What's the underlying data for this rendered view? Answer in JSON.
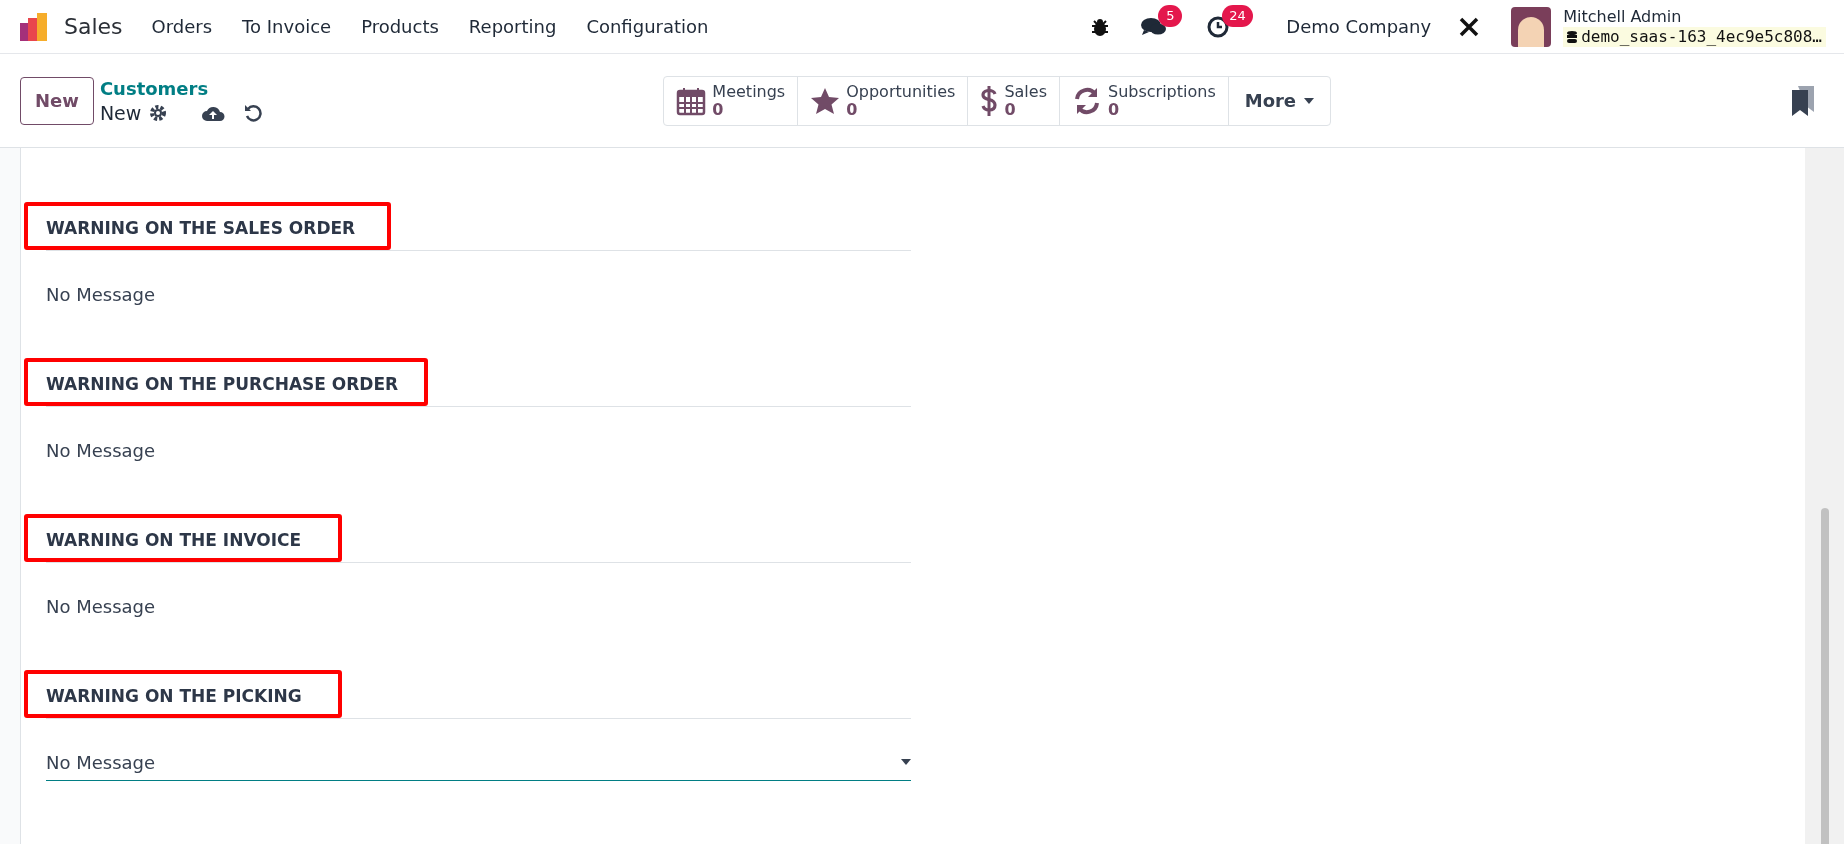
{
  "navbar": {
    "app": "Sales",
    "menu": [
      "Orders",
      "To Invoice",
      "Products",
      "Reporting",
      "Configuration"
    ],
    "messages_count": "5",
    "activities_count": "24",
    "company": "Demo Company",
    "user": "Mitchell Admin",
    "database": "demo_saas-163_4ec9e5c808…"
  },
  "control_panel": {
    "new_button": "New",
    "breadcrumb": "Customers",
    "record": "New",
    "stats": [
      {
        "kind": "calendar",
        "label": "Meetings",
        "value": "0"
      },
      {
        "kind": "star",
        "label": "Opportunities",
        "value": "0"
      },
      {
        "kind": "dollar",
        "label": "Sales",
        "value": "0"
      },
      {
        "kind": "refresh",
        "label": "Subscriptions",
        "value": "0"
      }
    ],
    "more": "More"
  },
  "sections": [
    {
      "title": "WARNING ON THE SALES ORDER",
      "kind": "text",
      "value": "No Message",
      "highlighted": true
    },
    {
      "title": "WARNING ON THE PURCHASE ORDER",
      "kind": "text",
      "value": "No Message",
      "highlighted": true
    },
    {
      "title": "WARNING ON THE INVOICE",
      "kind": "text",
      "value": "No Message",
      "highlighted": true
    },
    {
      "title": "WARNING ON THE PICKING",
      "kind": "select",
      "value": "No Message",
      "highlighted": true
    }
  ]
}
